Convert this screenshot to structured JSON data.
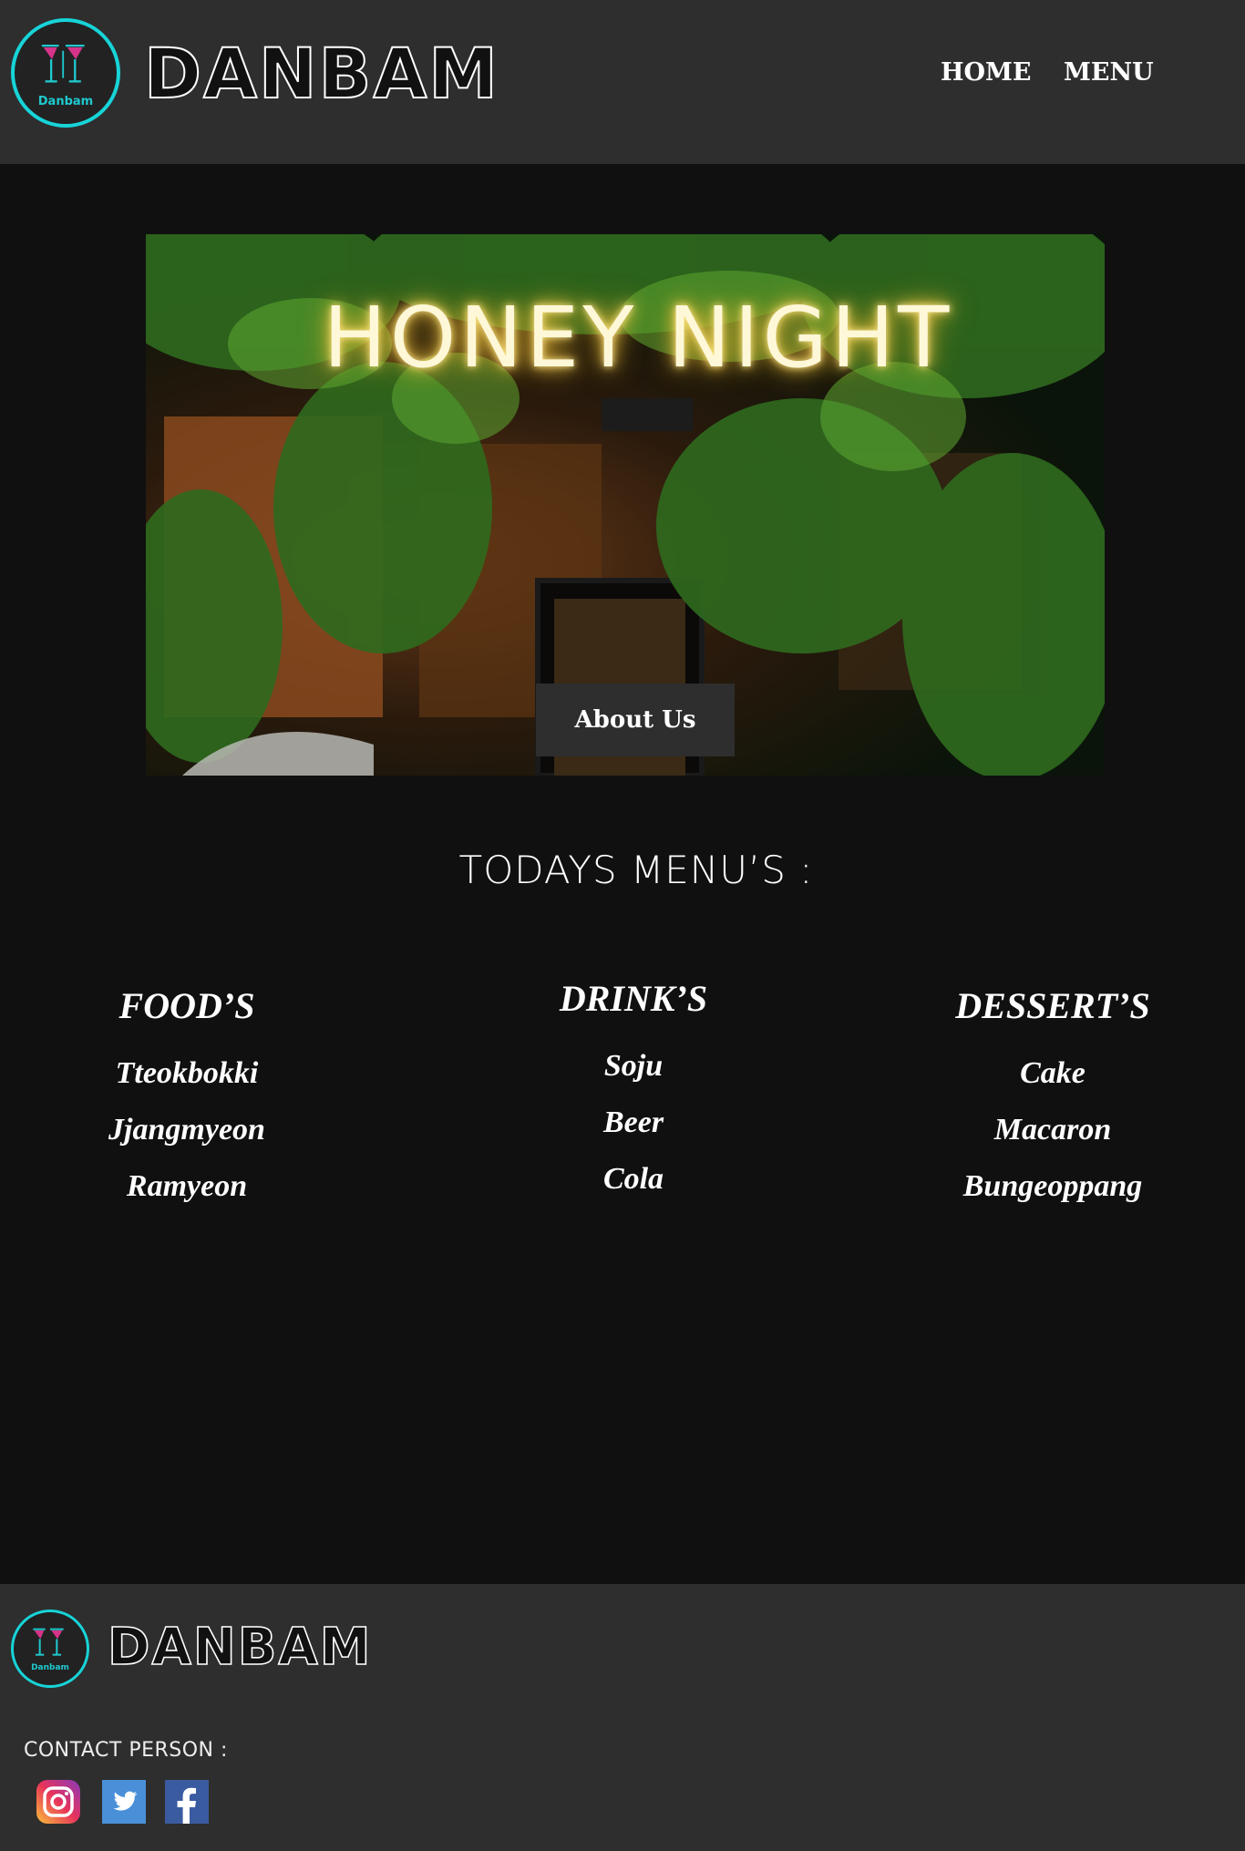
{
  "header": {
    "brand": "DANBAM",
    "logo_badge_text": "Danbam",
    "nav": [
      {
        "label": "HOME"
      },
      {
        "label": "MENU"
      }
    ]
  },
  "hero": {
    "neon_sign": "HONEY NIGHT",
    "about_button": "About Us"
  },
  "menu": {
    "title": "TODAYS MENU’S :",
    "columns": [
      {
        "heading": "FOOD’S",
        "items": [
          "Tteokbokki",
          "Jjangmyeon",
          "Ramyeon"
        ]
      },
      {
        "heading": "DRINK’S",
        "items": [
          "Soju",
          "Beer",
          "Cola"
        ]
      },
      {
        "heading": "DESSERT’S",
        "items": [
          "Cake",
          "Macaron",
          "Bungeoppang"
        ]
      }
    ]
  },
  "footer": {
    "brand": "DANBAM",
    "logo_badge_text": "Danbam",
    "contact_label": "CONTACT PERSON :",
    "social": [
      {
        "icon": "instagram-icon"
      },
      {
        "icon": "twitter-icon"
      },
      {
        "icon": "facebook-icon"
      }
    ]
  },
  "colors": {
    "header_bg": "#2e2e2e",
    "page_bg": "#101010",
    "logo_ring": "#17d4d8",
    "text": "#ffffff"
  }
}
